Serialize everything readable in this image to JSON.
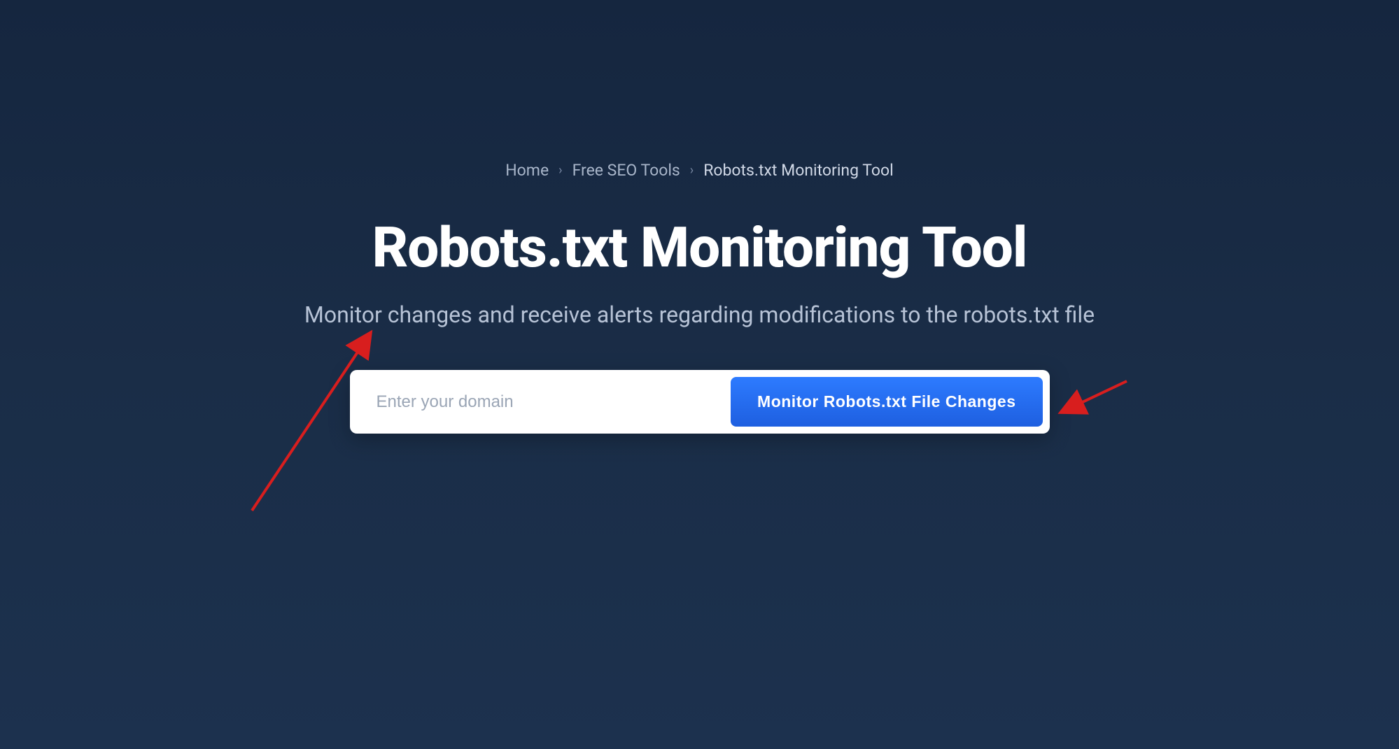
{
  "breadcrumb": {
    "home": "Home",
    "tools": "Free SEO Tools",
    "current": "Robots.txt Monitoring Tool"
  },
  "hero": {
    "title": "Robots.txt Monitoring Tool",
    "subtitle": "Monitor changes and receive alerts regarding modifications to the robots.txt file"
  },
  "form": {
    "placeholder": "Enter your domain",
    "button": "Monitor Robots.txt File Changes"
  }
}
